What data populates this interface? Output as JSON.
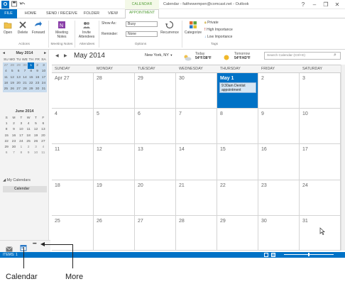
{
  "window": {
    "app_letter": "O",
    "contextual_tab": "CALENDAR TOOLS",
    "title": "Calendar - faithewempen@comcast.net - Outlook",
    "help": "?",
    "minimize": "–",
    "restore": "❐",
    "close": "✕"
  },
  "tabs": [
    "FILE",
    "HOME",
    "SEND / RECEIVE",
    "FOLDER",
    "VIEW",
    "APPOINTMENT"
  ],
  "ribbon": {
    "open": "Open",
    "delete": "Delete",
    "forward": "Forward",
    "meeting_notes_1": "Meeting",
    "meeting_notes_2": "Notes",
    "invite_1": "Invite",
    "invite_2": "Attendees",
    "show_as": "Show As:",
    "show_as_value": "Busy",
    "reminder": "Reminder:",
    "reminder_value": "None",
    "recurrence": "Recurrence",
    "categorize": "Categorize",
    "private": "Private",
    "high_importance": "High Importance",
    "low_importance": "Low Importance",
    "groups": [
      "Actions",
      "Meeting Notes",
      "Attendees",
      "Options",
      "Tags"
    ]
  },
  "nav": {
    "may_title": "May 2014",
    "june_title": "June 2014",
    "weekdays": [
      "SU",
      "MO",
      "TU",
      "WE",
      "TH",
      "FR",
      "SA"
    ],
    "june_weekdays": [
      "S",
      "M",
      "T",
      "W",
      "T",
      "F"
    ],
    "may_rows": [
      [
        "27",
        "28",
        "29",
        "30",
        "1",
        "2",
        "3"
      ],
      [
        "4",
        "5",
        "6",
        "7",
        "8",
        "9",
        "10"
      ],
      [
        "11",
        "12",
        "13",
        "14",
        "15",
        "16",
        "17"
      ],
      [
        "18",
        "19",
        "20",
        "21",
        "22",
        "23",
        "24"
      ],
      [
        "25",
        "26",
        "27",
        "28",
        "29",
        "30",
        "31"
      ]
    ],
    "june_rows": [
      [
        "1",
        "2",
        "3",
        "4",
        "5",
        "6"
      ],
      [
        "8",
        "9",
        "10",
        "11",
        "12",
        "13"
      ],
      [
        "15",
        "16",
        "17",
        "18",
        "19",
        "20"
      ],
      [
        "22",
        "23",
        "24",
        "25",
        "26",
        "27"
      ],
      [
        "29",
        "30",
        "1",
        "2",
        "3",
        "4"
      ],
      [
        "6",
        "7",
        "8",
        "9",
        "10",
        "11"
      ]
    ],
    "my_calendars": "My Calendars",
    "calendar_item": "Calendar"
  },
  "header": {
    "prev": "◀",
    "next": "▶",
    "month": "May 2014",
    "location": "New York, NY",
    "today_label": "Today",
    "today_temp": "54°F/38°F",
    "tomorrow_label": "Tomorrow",
    "tomorrow_temp": "54°F/43°F",
    "search_placeholder": "Search Calendar (Ctrl+E)"
  },
  "calendar": {
    "days": [
      "SUNDAY",
      "MONDAY",
      "TUESDAY",
      "WEDNESDAY",
      "THURSDAY",
      "FRIDAY",
      "SATURDAY"
    ],
    "weeks": [
      [
        "Apr 27",
        "28",
        "29",
        "30",
        "May 1",
        "2",
        "3"
      ],
      [
        "4",
        "5",
        "6",
        "7",
        "8",
        "9",
        "10"
      ],
      [
        "11",
        "12",
        "13",
        "14",
        "15",
        "16",
        "17"
      ],
      [
        "18",
        "19",
        "20",
        "21",
        "22",
        "23",
        "24"
      ],
      [
        "25",
        "26",
        "27",
        "28",
        "29",
        "30",
        "31"
      ]
    ],
    "appointment": "9:30am Dentist appointment"
  },
  "status": {
    "items": "ITEMS: 1"
  },
  "callouts": {
    "calendar": "Calendar",
    "more": "More"
  },
  "bottom_nav": {
    "more_dots": "• • •"
  }
}
